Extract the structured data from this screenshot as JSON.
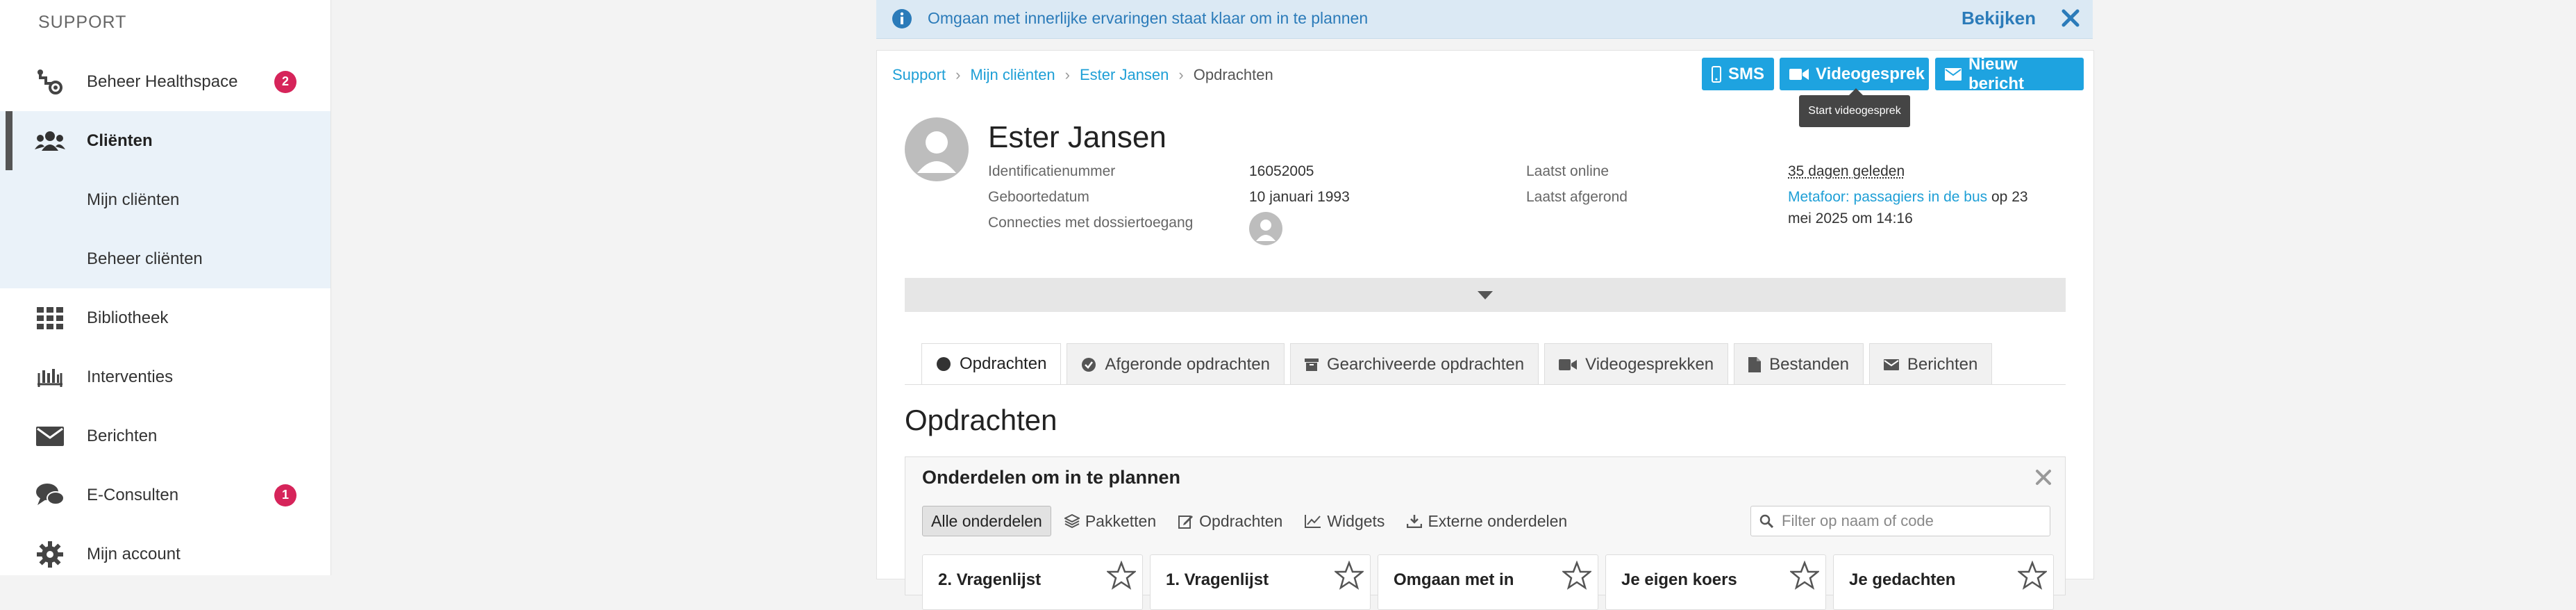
{
  "sidebar": {
    "header": "SUPPORT",
    "items": [
      {
        "label": "Beheer Healthspace",
        "icon": "healthspace-settings-icon",
        "badge": "2"
      },
      {
        "label": "Cliënten",
        "icon": "users-icon"
      },
      {
        "label": "Mijn cliënten"
      },
      {
        "label": "Beheer cliënten"
      },
      {
        "label": "Bibliotheek",
        "icon": "grid-icon"
      },
      {
        "label": "Interventies",
        "icon": "interventions-icon"
      },
      {
        "label": "Berichten",
        "icon": "envelope-icon"
      },
      {
        "label": "E-Consulten",
        "icon": "chat-bubbles-icon",
        "badge": "1"
      },
      {
        "label": "Mijn account",
        "icon": "gear-icon"
      }
    ]
  },
  "notification": {
    "text": "Omgaan met innerlijke ervaringen staat klaar om in te plannen",
    "link": "Bekijken"
  },
  "breadcrumb": {
    "items": [
      "Support",
      "Mijn cliënten",
      "Ester Jansen"
    ],
    "current": "Opdrachten"
  },
  "actions": {
    "sms": "SMS",
    "video": "Videogesprek",
    "message": "Nieuw bericht",
    "video_tooltip": "Start videogesprek"
  },
  "client": {
    "name": "Ester Jansen",
    "id_label": "Identificatienummer",
    "id_value": "16052005",
    "dob_label": "Geboortedatum",
    "dob_value": "10 januari 1993",
    "connections_label": "Connecties met dossiertoegang",
    "online_label": "Laatst online",
    "online_value": "35 dagen geleden",
    "completed_label": "Laatst afgerond",
    "completed_link": "Metafoor: passagiers in de bus",
    "completed_suffix": " op 23",
    "completed_line2": "mei 2025 om 14:16"
  },
  "tabs": [
    {
      "label": "Opdrachten",
      "icon": "circle-icon"
    },
    {
      "label": "Afgeronde opdrachten",
      "icon": "check-circle-icon"
    },
    {
      "label": "Gearchiveerde opdrachten",
      "icon": "archive-icon"
    },
    {
      "label": "Videogesprekken",
      "icon": "video-icon"
    },
    {
      "label": "Bestanden",
      "icon": "file-icon"
    },
    {
      "label": "Berichten",
      "icon": "envelope-icon"
    }
  ],
  "section_title": "Opdrachten",
  "plan_panel": {
    "title": "Onderdelen om in te plannen",
    "filters": [
      {
        "label": "Alle onderdelen",
        "active": true
      },
      {
        "label": "Pakketten",
        "icon": "layers-icon"
      },
      {
        "label": "Opdrachten",
        "icon": "edit-icon"
      },
      {
        "label": "Widgets",
        "icon": "chart-icon"
      },
      {
        "label": "Externe onderdelen",
        "icon": "download-icon"
      }
    ],
    "search_placeholder": "Filter op naam of code",
    "tiles": [
      "2. Vragenlijst",
      "1. Vragenlijst",
      "Omgaan met in",
      "Je eigen koers",
      "Je gedachten"
    ]
  },
  "colors": {
    "accent": "#1ea3e0",
    "badge": "#d6245a",
    "notification_bg": "#dbe9f4",
    "link": "#1e9fd6"
  }
}
